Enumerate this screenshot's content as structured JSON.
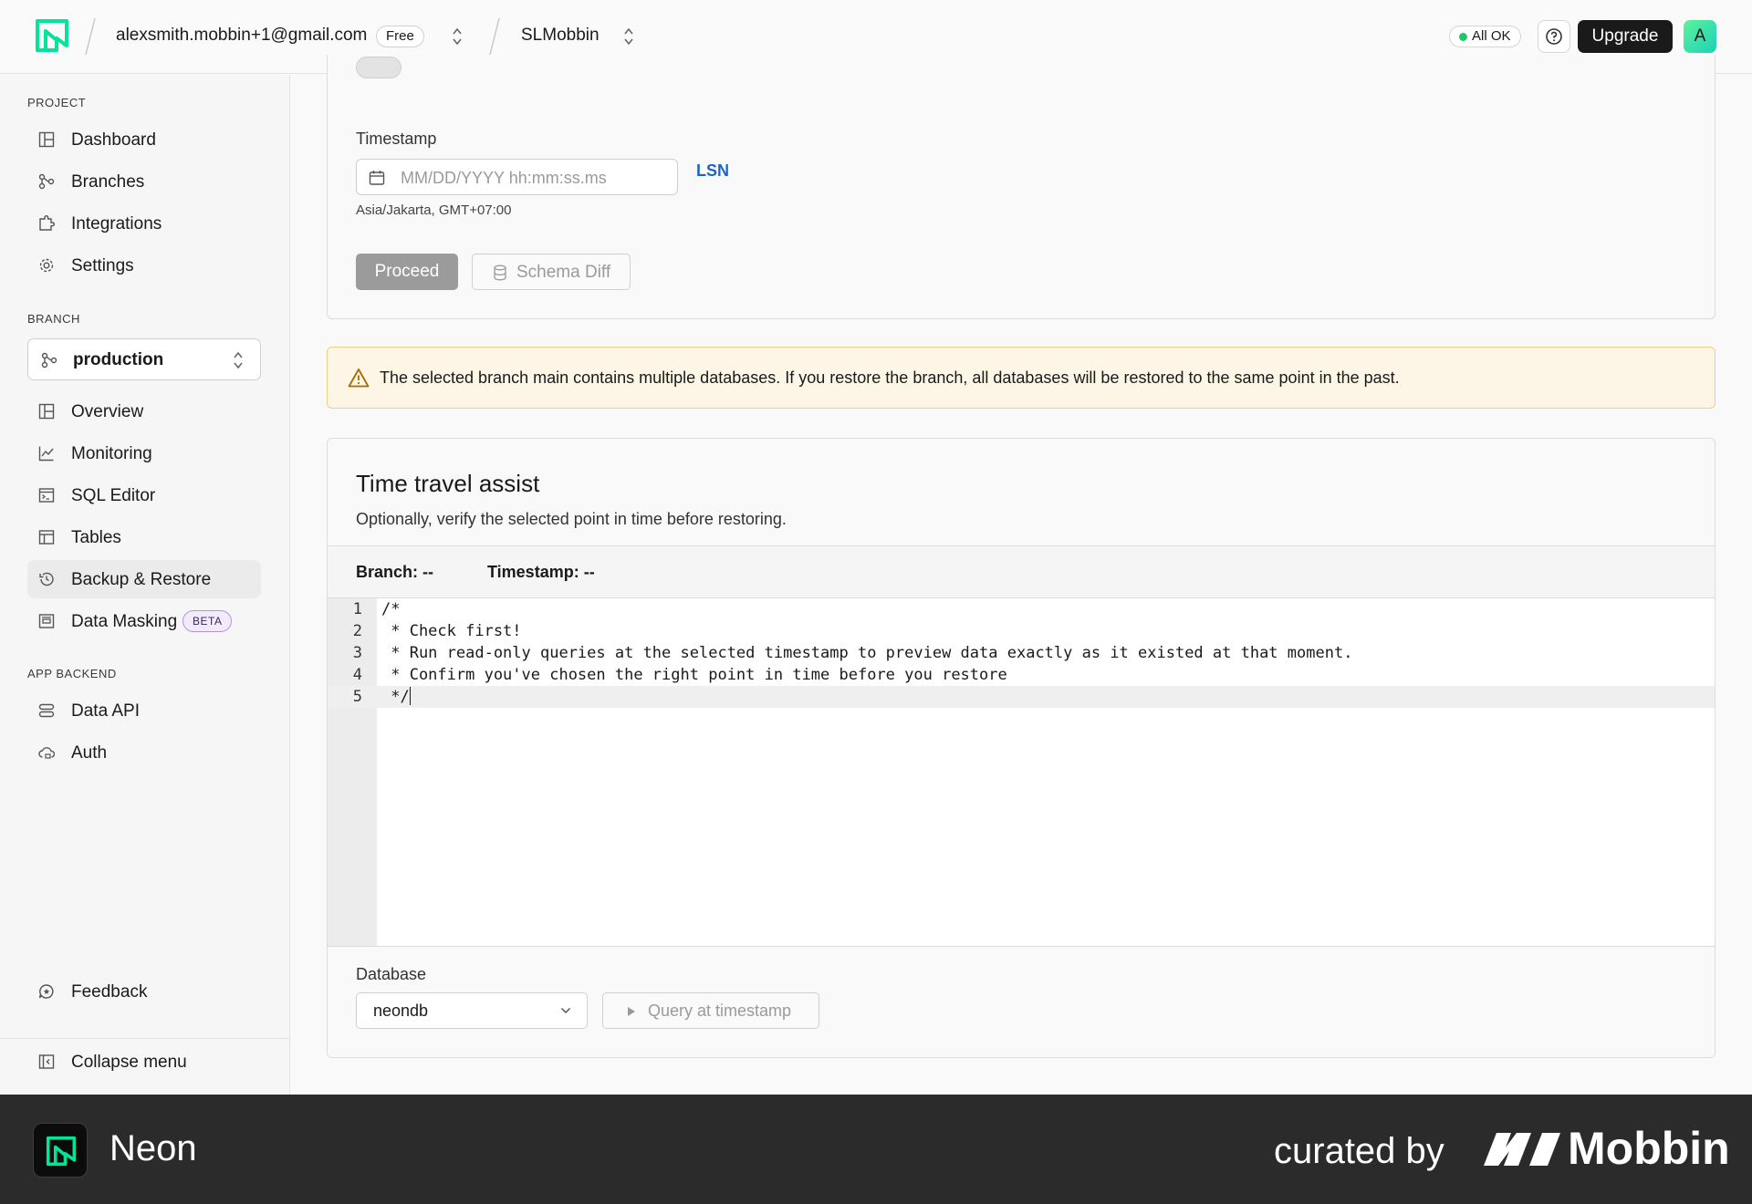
{
  "topbar": {
    "account_email": "alexsmith.mobbin+1@gmail.com",
    "plan_badge": "Free",
    "project_name": "SLMobbin",
    "status_text": "All OK",
    "upgrade_label": "Upgrade",
    "avatar_initial": "A",
    "colors": {
      "status_dot": "#1fc76a",
      "brand": "#00e599",
      "upgrade_bg": "#1a1a1a"
    }
  },
  "sidebar": {
    "project_section": "PROJECT",
    "project_items": [
      {
        "label": "Dashboard",
        "icon": "dashboard-icon"
      },
      {
        "label": "Branches",
        "icon": "branches-icon"
      },
      {
        "label": "Integrations",
        "icon": "puzzle-icon"
      },
      {
        "label": "Settings",
        "icon": "gear-icon"
      }
    ],
    "branch_section": "BRANCH",
    "branch_selected": "production",
    "branch_items": [
      {
        "label": "Overview",
        "icon": "grid-icon"
      },
      {
        "label": "Monitoring",
        "icon": "chart-icon"
      },
      {
        "label": "SQL Editor",
        "icon": "terminal-icon"
      },
      {
        "label": "Tables",
        "icon": "table-icon"
      },
      {
        "label": "Backup & Restore",
        "icon": "history-icon",
        "active": true
      },
      {
        "label": "Data Masking",
        "icon": "mask-icon",
        "badge": "BETA"
      }
    ],
    "backend_section": "APP BACKEND",
    "backend_items": [
      {
        "label": "Data API",
        "icon": "api-icon"
      },
      {
        "label": "Auth",
        "icon": "cloud-lock-icon"
      }
    ],
    "feedback_label": "Feedback",
    "collapse_label": "Collapse menu"
  },
  "restore": {
    "timestamp_label": "Timestamp",
    "timestamp_placeholder": "MM/DD/YYYY hh:mm:ss.ms",
    "lsn_link": "LSN",
    "timezone": "Asia/Jakarta, GMT+07:00",
    "proceed_label": "Proceed",
    "schema_diff_label": "Schema Diff"
  },
  "warning": {
    "text": "The selected branch main contains multiple databases. If you restore the branch, all databases will be restored to the same point in the past."
  },
  "time_travel": {
    "title": "Time travel assist",
    "subtitle": "Optionally, verify the selected point in time before restoring.",
    "branch_text": "Branch: --",
    "timestamp_text": "Timestamp: --",
    "code_lines": [
      {
        "n": "1",
        "text": "/*"
      },
      {
        "n": "2",
        "text": " * Check first!"
      },
      {
        "n": "3",
        "text": " * Run read-only queries at the selected timestamp to preview data exactly as it existed at that moment."
      },
      {
        "n": "4",
        "text": " * Confirm you've chosen the right point in time before you restore"
      },
      {
        "n": "5",
        "text": " */"
      }
    ],
    "database_label": "Database",
    "database_selected": "neondb",
    "query_button": "Query at timestamp"
  },
  "footer": {
    "app_name": "Neon",
    "curated_by": "curated by",
    "brand": "Mobbin"
  }
}
